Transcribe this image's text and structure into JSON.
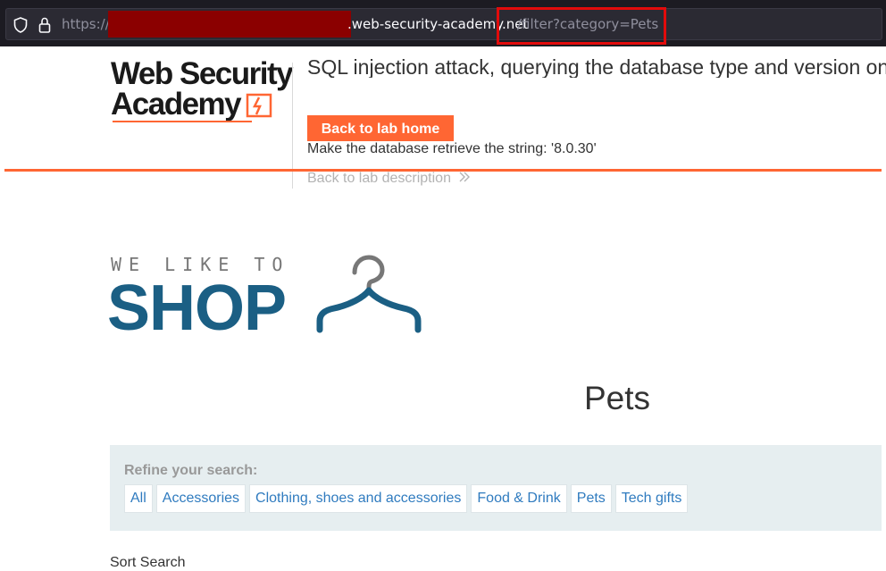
{
  "browser": {
    "url_scheme": "https://",
    "url_host": ".web-security-academy.net",
    "url_path": "/filter?category=Pets",
    "icons": [
      "shield-icon",
      "lock-icon"
    ]
  },
  "academy": {
    "logo_line1": "Web Security",
    "logo_line2": "Academy",
    "lab_title": "SQL injection attack, querying the database type and version on MySQL and Microsoft",
    "back_button": "Back to lab home",
    "goal": "Make the database retrieve the string: '8.0.30'",
    "back_description": "Back to lab description"
  },
  "shop": {
    "tagline": "WE LIKE TO",
    "name": "SHOP"
  },
  "page": {
    "heading": "Pets",
    "refine_label": "Refine your search:",
    "categories": [
      "All",
      "Accessories",
      "Clothing, shoes and accessories",
      "Food & Drink",
      "Pets",
      "Tech gifts"
    ],
    "sort_label": "Sort Search"
  },
  "colors": {
    "accent": "#ff6633",
    "shop_blue": "#1b5f84",
    "link": "#2f7bbf",
    "highlight": "#e20b0b"
  }
}
